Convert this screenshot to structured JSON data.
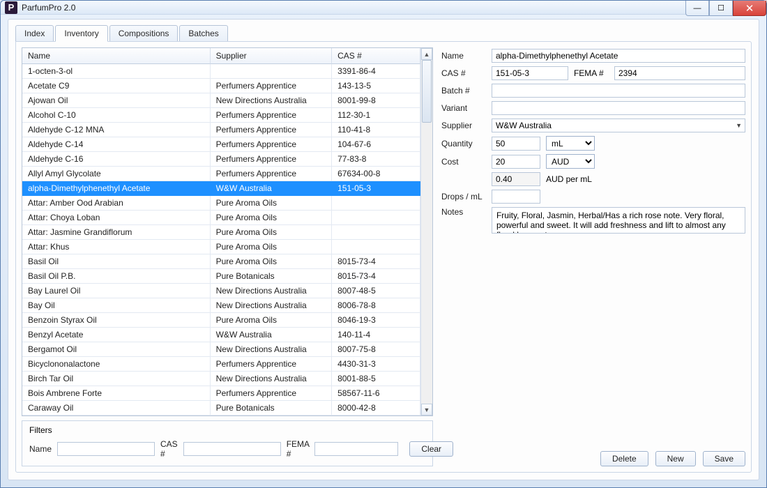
{
  "window": {
    "title": "ParfumPro 2.0",
    "icon_letter": "P"
  },
  "tabs": [
    {
      "label": "Index",
      "active": false
    },
    {
      "label": "Inventory",
      "active": true
    },
    {
      "label": "Compositions",
      "active": false
    },
    {
      "label": "Batches",
      "active": false
    }
  ],
  "grid": {
    "headers": {
      "name": "Name",
      "supplier": "Supplier",
      "cas": "CAS #"
    },
    "rows": [
      {
        "name": "1-octen-3-ol",
        "supplier": "",
        "cas": "3391-86-4"
      },
      {
        "name": "Acetate C9",
        "supplier": "Perfumers Apprentice",
        "cas": "143-13-5"
      },
      {
        "name": "Ajowan Oil",
        "supplier": "New Directions Australia",
        "cas": "8001-99-8"
      },
      {
        "name": "Alcohol C-10",
        "supplier": "Perfumers Apprentice",
        "cas": "112-30-1"
      },
      {
        "name": "Aldehyde C-12 MNA",
        "supplier": "Perfumers Apprentice",
        "cas": "110-41-8"
      },
      {
        "name": "Aldehyde C-14",
        "supplier": "Perfumers Apprentice",
        "cas": "104-67-6"
      },
      {
        "name": "Aldehyde C-16",
        "supplier": "Perfumers Apprentice",
        "cas": "77-83-8"
      },
      {
        "name": "Allyl Amyl Glycolate",
        "supplier": "Perfumers Apprentice",
        "cas": "67634-00-8"
      },
      {
        "name": "alpha-Dimethylphenethyl Acetate",
        "supplier": "W&W Australia",
        "cas": "151-05-3",
        "selected": true
      },
      {
        "name": "Attar: Amber Ood Arabian",
        "supplier": "Pure Aroma Oils",
        "cas": ""
      },
      {
        "name": "Attar: Choya Loban",
        "supplier": "Pure Aroma Oils",
        "cas": ""
      },
      {
        "name": "Attar: Jasmine Grandiflorum",
        "supplier": "Pure Aroma Oils",
        "cas": ""
      },
      {
        "name": "Attar: Khus",
        "supplier": "Pure Aroma Oils",
        "cas": ""
      },
      {
        "name": "Basil Oil",
        "supplier": "Pure Aroma Oils",
        "cas": "8015-73-4"
      },
      {
        "name": "Basil Oil P.B.",
        "supplier": "Pure Botanicals",
        "cas": "8015-73-4"
      },
      {
        "name": "Bay Laurel Oil",
        "supplier": "New Directions Australia",
        "cas": "8007-48-5"
      },
      {
        "name": "Bay Oil",
        "supplier": "New Directions Australia",
        "cas": "8006-78-8"
      },
      {
        "name": "Benzoin Styrax Oil",
        "supplier": "Pure Aroma Oils",
        "cas": "8046-19-3"
      },
      {
        "name": "Benzyl Acetate",
        "supplier": "W&W Australia",
        "cas": "140-11-4"
      },
      {
        "name": "Bergamot Oil",
        "supplier": "New Directions Australia",
        "cas": "8007-75-8"
      },
      {
        "name": "Bicyclononalactone",
        "supplier": "Perfumers Apprentice",
        "cas": "4430-31-3"
      },
      {
        "name": "Birch Tar Oil",
        "supplier": "New Directions Australia",
        "cas": "8001-88-5"
      },
      {
        "name": "Bois Ambrene Forte",
        "supplier": "Perfumers Apprentice",
        "cas": "58567-11-6"
      },
      {
        "name": "Caraway Oil",
        "supplier": "Pure Botanicals",
        "cas": "8000-42-8"
      }
    ]
  },
  "filters": {
    "legend": "Filters",
    "name_label": "Name",
    "cas_label": "CAS #",
    "fema_label": "FEMA #",
    "clear": "Clear"
  },
  "detail": {
    "name_label": "Name",
    "name": "alpha-Dimethylphenethyl Acetate",
    "cas_label": "CAS #",
    "cas": "151-05-3",
    "fema_label": "FEMA #",
    "fema": "2394",
    "batch_label": "Batch #",
    "batch": "",
    "variant_label": "Variant",
    "variant": "",
    "supplier_label": "Supplier",
    "supplier": "W&W Australia",
    "qty_label": "Quantity",
    "qty": "50",
    "qty_unit": "mL",
    "cost_label": "Cost",
    "cost": "20",
    "currency": "AUD",
    "unit_price": "0.40",
    "unit_price_label": "AUD per mL",
    "drops_label": "Drops / mL",
    "drops": "",
    "notes_label": "Notes",
    "notes": "Fruity, Floral, Jasmin, Herbal/Has a rich rose note. Very floral, powerful and sweet. It will add freshness and lift to almost any floral bouquet"
  },
  "actions": {
    "delete": "Delete",
    "new": "New",
    "save": "Save"
  }
}
